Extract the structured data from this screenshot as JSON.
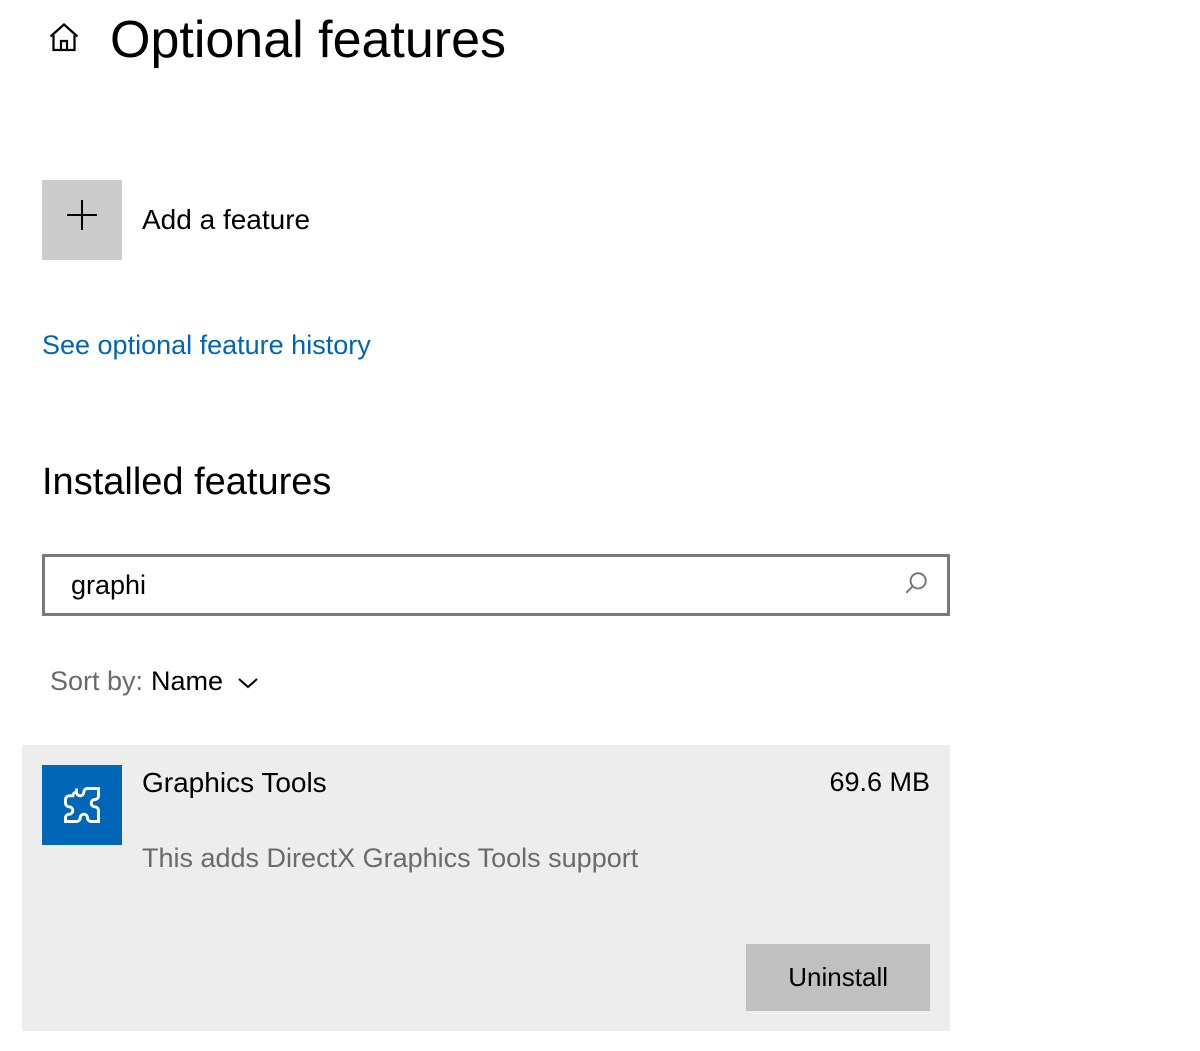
{
  "header": {
    "title": "Optional features"
  },
  "add_feature": {
    "label": "Add a feature"
  },
  "history_link": "See optional feature history",
  "installed_section": {
    "heading": "Installed features",
    "search_value": "graphi",
    "sort_label": "Sort by:",
    "sort_value": "Name"
  },
  "features": [
    {
      "title": "Graphics Tools",
      "size": "69.6 MB",
      "description": "This adds DirectX Graphics Tools support",
      "uninstall_label": "Uninstall"
    }
  ]
}
